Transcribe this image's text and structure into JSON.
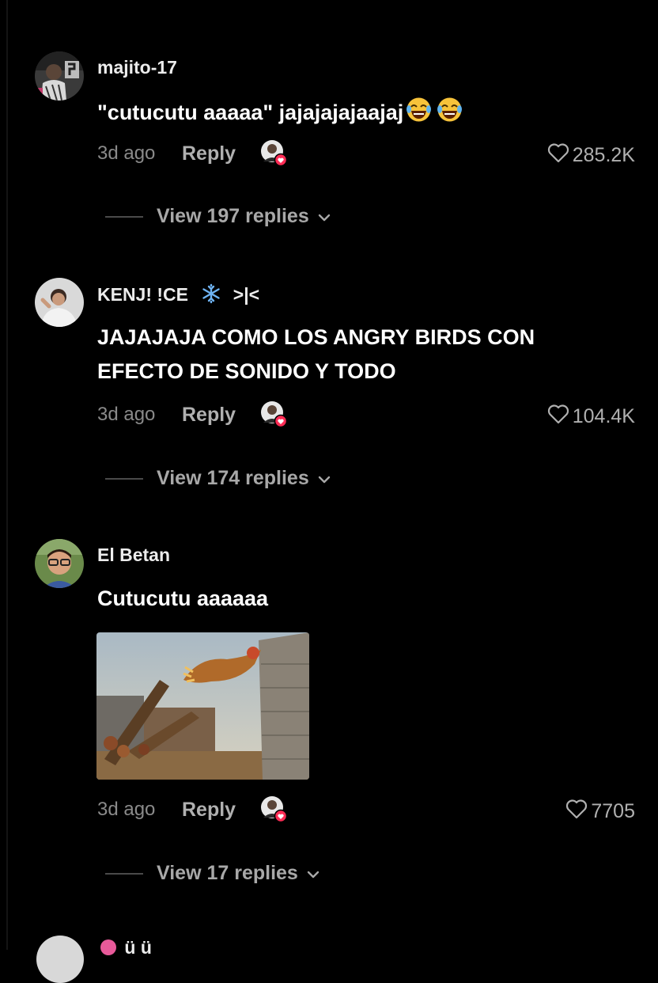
{
  "comments": [
    {
      "username": "majito-17",
      "text": "\"cutucutu aaaaa\" jajajajajaajaj",
      "emojis": [
        "face-with-tears-of-joy",
        "face-with-tears-of-joy"
      ],
      "time": "3d ago",
      "reply_label": "Reply",
      "likes": "285.2K",
      "view_replies": "View 197 replies"
    },
    {
      "username": "KENJ! !CE",
      "username_suffix": ">|<",
      "username_icon": "snowflake-icon",
      "text_lines": [
        "JAJAJAJA COMO LOS ANGRY BIRDS CON",
        "EFECTO DE SONIDO Y TODO"
      ],
      "time": "3d ago",
      "reply_label": "Reply",
      "likes": "104.4K",
      "view_replies": "View 174 replies"
    },
    {
      "username": "El Betan",
      "text": "Cutucutu aaaaaa",
      "attachment": "chicken-catapult-image",
      "time": "3d ago",
      "reply_label": "Reply",
      "likes": "7705",
      "view_replies": "View 17 replies"
    }
  ],
  "partial_next_username": "ü ü"
}
